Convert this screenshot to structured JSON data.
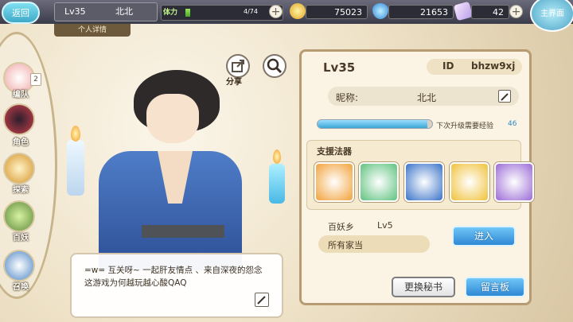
{
  "header": {
    "back_label": "返回",
    "level": "Lv35",
    "player_name": "北北",
    "detail_tab": "个人详情",
    "stamina_label": "体力",
    "stamina_value": "4/74",
    "stamina_fraction": 0.05,
    "gold": "75023",
    "gems": "21653",
    "tickets": "42",
    "main_menu_label": "主界面"
  },
  "nav": {
    "items": [
      {
        "label": "编队",
        "badge": "2"
      },
      {
        "label": "角色"
      },
      {
        "label": "探索"
      },
      {
        "label": "百妖"
      },
      {
        "label": "召唤"
      }
    ]
  },
  "share_label": "分享",
  "bubble": {
    "text": "=w= 互关呀~ 一起肝友情点 、来自深夜的怨念 这游戏为何越玩越心酸QAQ"
  },
  "profile": {
    "level": "Lv35",
    "id_label": "ID",
    "id_value": "bhzw9xj",
    "nickname_label": "昵称:",
    "nickname": "北北",
    "exp_label": "下次升级需要经验",
    "exp_value": "46",
    "exp_fraction": 0.96,
    "support_title": "支援法器",
    "support_slot_colors": [
      "#f2a23a",
      "#5fc27f",
      "#3a73c8",
      "#f0c23a",
      "#9b6bd6"
    ],
    "yaoxiang": "百妖乡",
    "yaoxiang_level": "Lv5",
    "house_label": "所有家当",
    "enter_button": "进入",
    "change_secretary_button": "更换秘书",
    "message_board_button": "留言板"
  }
}
